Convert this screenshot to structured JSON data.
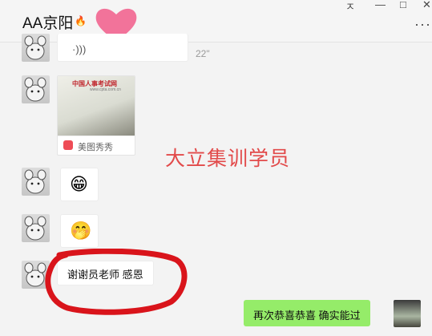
{
  "header": {
    "title": "AA京阳",
    "title_emoji": "🔥",
    "more": "···",
    "window_controls": [
      "ㅈ",
      "—",
      "□",
      "✕"
    ]
  },
  "messages": {
    "voice": {
      "duration": "22\"",
      "icon": "voice-wave-icon"
    },
    "share": {
      "thumb_title": "中国人事考试网",
      "thumb_url": "www.cpta.com.cn",
      "source_label": "美图秀秀"
    },
    "emoji1": "😁",
    "emoji2": "🤭",
    "text_in": "谢谢员老师 感恩",
    "text_out": "再次恭喜恭喜 确实能过"
  },
  "overlay": {
    "watermark": "大立集训学员"
  },
  "colors": {
    "accent_green": "#95ec69",
    "watermark_red": "#e24a4a",
    "annotation_red": "#d9141b",
    "heart_pink": "#f2739a"
  }
}
